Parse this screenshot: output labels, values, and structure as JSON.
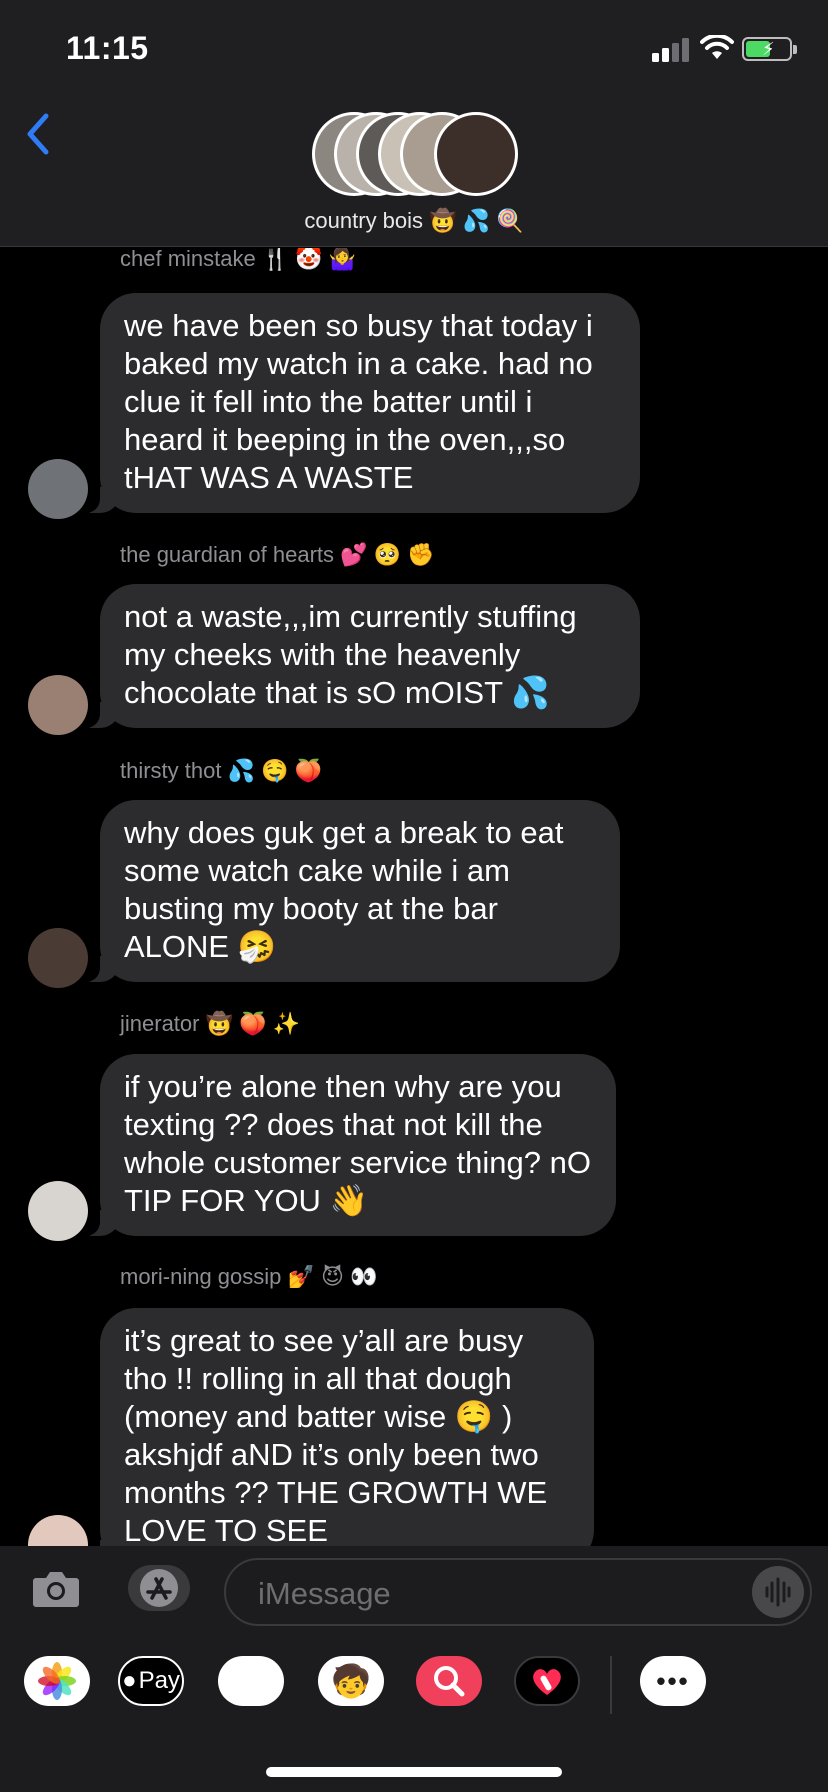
{
  "status_bar": {
    "time": "11:15"
  },
  "header": {
    "group_name": "country bois 🤠 💦 🍭",
    "avatar_colors": [
      "#8b8680",
      "#b8b2aa",
      "#5d5a57",
      "#c9c1b6",
      "#a99c90",
      "#3c2e29"
    ]
  },
  "messages": [
    {
      "sender": "chef minstake 🍴 🤡 🤷‍♀️",
      "text": "we have been so busy that today i baked my watch in a cake. had no clue it fell into the batter until i heard it beeping in the oven,,,so tHAT WAS A WASTE",
      "avatar_color": "#6f7378"
    },
    {
      "sender": "the guardian of hearts 💕 🥺 ✊",
      "text": "not a waste,,,im currently stuffing my cheeks with the heavenly chocolate that is sO mOIST 💦",
      "avatar_color": "#9a7f73"
    },
    {
      "sender": "thirsty thot 💦 🤤 🍑",
      "text": "why does guk get a break to eat some watch cake while i am busting my booty at the bar ALONE 🤧",
      "avatar_color": "#4a3b34"
    },
    {
      "sender": "jinerator 🤠 🍑 ✨",
      "text": "if you’re alone then why are you texting ?? does that not kill the whole customer service thing? nO TIP FOR YOU 👋",
      "avatar_color": "#d8d4d0"
    },
    {
      "sender": "mori-ning gossip 💅 😈 👀",
      "text": "it’s great to see y’all are busy tho !! rolling in all that dough (money and batter wise 🤤 ) akshjdf aND it’s only been two months ?? THE GROWTH WE LOVE TO SEE",
      "avatar_color": "#e3c9bd"
    }
  ],
  "composer": {
    "placeholder": "iMessage"
  },
  "apps": [
    {
      "name": "photos-app-icon",
      "label": ""
    },
    {
      "name": "apple-pay-icon",
      "label": "Pay"
    },
    {
      "name": "animoji-icon",
      "label": "🐵"
    },
    {
      "name": "memoji-icon",
      "label": "🧒"
    },
    {
      "name": "images-search-icon",
      "label": ""
    },
    {
      "name": "digital-touch-icon",
      "label": ""
    },
    {
      "name": "more-apps-icon",
      "label": "•••"
    }
  ]
}
